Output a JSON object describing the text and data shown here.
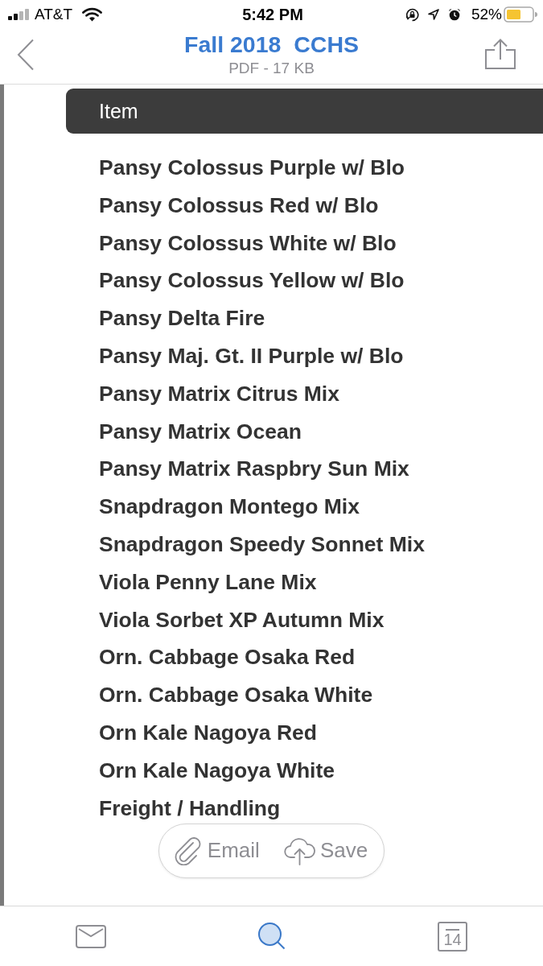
{
  "status_bar": {
    "carrier": "AT&T",
    "time": "5:42 PM",
    "battery_percent": "52%"
  },
  "nav_bar": {
    "title": "Fall 2018  CCHS",
    "subtitle": "PDF - 17 KB"
  },
  "document": {
    "table": {
      "columns": [
        "Item"
      ],
      "rows": [
        "Pansy Colossus Purple w/ Blo",
        "Pansy Colossus Red w/ Blo",
        "Pansy Colossus White w/ Blo",
        "Pansy Colossus Yellow w/ Blo",
        "Pansy Delta Fire",
        "Pansy Maj. Gt. II Purple w/ Blo",
        "Pansy Matrix Citrus Mix",
        "Pansy Matrix Ocean",
        "Pansy Matrix Raspbry Sun Mix",
        "Snapdragon Montego Mix",
        "Snapdragon Speedy Sonnet Mix",
        "Viola Penny Lane Mix",
        "Viola Sorbet XP Autumn Mix",
        "Orn. Cabbage Osaka Red",
        "Orn. Cabbage Osaka White",
        "Orn Kale Nagoya Red",
        "Orn Kale Nagoya White",
        "Freight / Handling"
      ]
    }
  },
  "actions": [
    {
      "kind": "email",
      "label": "Email"
    },
    {
      "kind": "save",
      "label": "Save"
    }
  ],
  "tab_bar": [
    {
      "kind": "mail",
      "selected": false
    },
    {
      "kind": "search",
      "selected": true
    },
    {
      "kind": "calendar",
      "label": "14",
      "selected": false
    }
  ]
}
